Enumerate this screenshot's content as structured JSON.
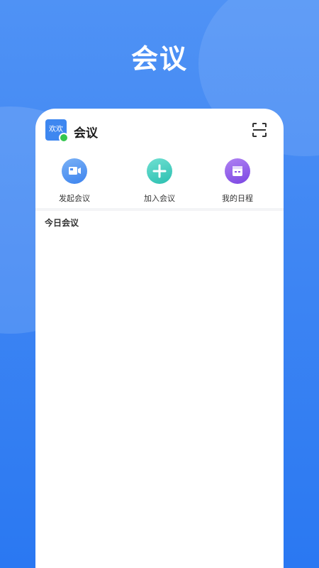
{
  "hero": {
    "title": "会议"
  },
  "header": {
    "avatar_text": "欢欢",
    "title": "会议",
    "scan_icon": "scan-icon"
  },
  "actions": [
    {
      "label": "发起会议",
      "icon": "video-camera-icon",
      "color": "#4d8ff2"
    },
    {
      "label": "加入会议",
      "icon": "plus-icon",
      "color": "#3ccbbd"
    },
    {
      "label": "我的日程",
      "icon": "calendar-icon",
      "color": "#8a54e6"
    }
  ],
  "section": {
    "title": "今日会议"
  },
  "colors": {
    "background_top": "#4f92f5",
    "background_bottom": "#2a78f2",
    "status_dot": "#35c64f"
  }
}
